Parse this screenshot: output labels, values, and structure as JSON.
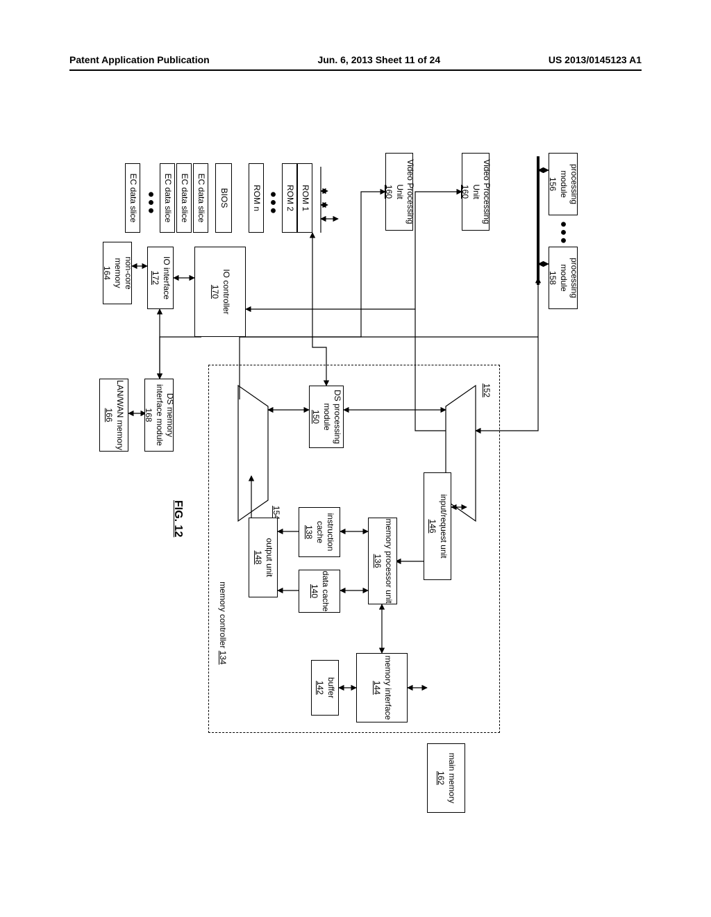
{
  "header": {
    "left": "Patent Application Publication",
    "center": "Jun. 6, 2013   Sheet 11 of 24",
    "right": "US 2013/0145123 A1"
  },
  "fig": "FIG. 12",
  "b": {
    "proc_mod_1": "processing module",
    "proc_mod_1r": "156",
    "proc_mod_2": "processing module",
    "proc_mod_2r": "158",
    "video": "Video Processing Unit",
    "video_r": "160",
    "ir_unit": "input/request unit",
    "ir_unit_r": "146",
    "mp": "memory processor unit",
    "mp_r": "136",
    "mi": "memory interface",
    "mi_r": "144",
    "main": "main memory",
    "main_r": "162",
    "buf": "buffer",
    "buf_r": "142",
    "ic": "instruction cache",
    "ic_r": "138",
    "dc": "data cache",
    "dc_r": "140",
    "out": "output unit",
    "out_r": "148",
    "ds": "DS processing module",
    "ds_r": "150",
    "mc": "memory controller",
    "mc_r": "134",
    "dsmi": "DS memory interface module",
    "dsmi_r": "168",
    "lw": "LAN/WAN memory",
    "lw_r": "166",
    "noncore": "non-core memory",
    "noncore_r": "164",
    "ioctrl": "IO controller",
    "ioctrl_r": "170",
    "ioif": "IO interface",
    "ioif_r": "172",
    "mux1": "152",
    "mux2": "154",
    "rom1": "ROM 1",
    "rom2": "ROM 2",
    "romn": "ROM n",
    "bios": "BIOS",
    "ec": "EC data slice"
  }
}
